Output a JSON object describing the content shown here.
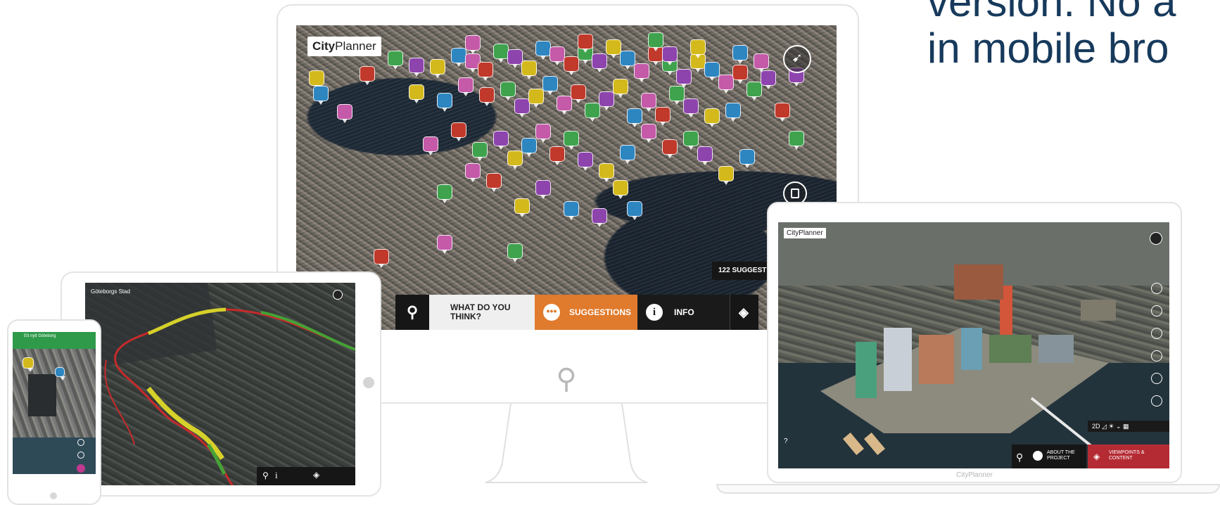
{
  "headline": {
    "line1": "version. No a",
    "line2": "in mobile bro"
  },
  "desktop": {
    "logo_bold": "City",
    "logo_thin": "Planner",
    "count_badge": "122 SUGGEST",
    "toolbar": {
      "what_line1": "WHAT DO YOU",
      "what_line2": "THINK?",
      "suggestions": "SUGGESTIONS",
      "info": "INFO"
    },
    "colors": {
      "suggestions_bg": "#e07a2c",
      "info_bg": "#1a1a1a",
      "what_bg": "#f0f0f0",
      "pin_bg": "#161616"
    },
    "marker_colors": [
      "#c0392b",
      "#3fa34d",
      "#8e44ad",
      "#d4b91c",
      "#2e86c1",
      "#c45aa8"
    ]
  },
  "laptop": {
    "logo": "CityPlanner",
    "brand": "CityPlanner",
    "view_toggle": "2D",
    "about": "ABOUT THE PROJECT",
    "viewpoints": "VIEWPOINTS & CONTENT",
    "help": "?"
  },
  "tablet": {
    "logo": "Göteborgs Stad"
  },
  "phone": {
    "header": "Ett nytt Göteborg"
  }
}
